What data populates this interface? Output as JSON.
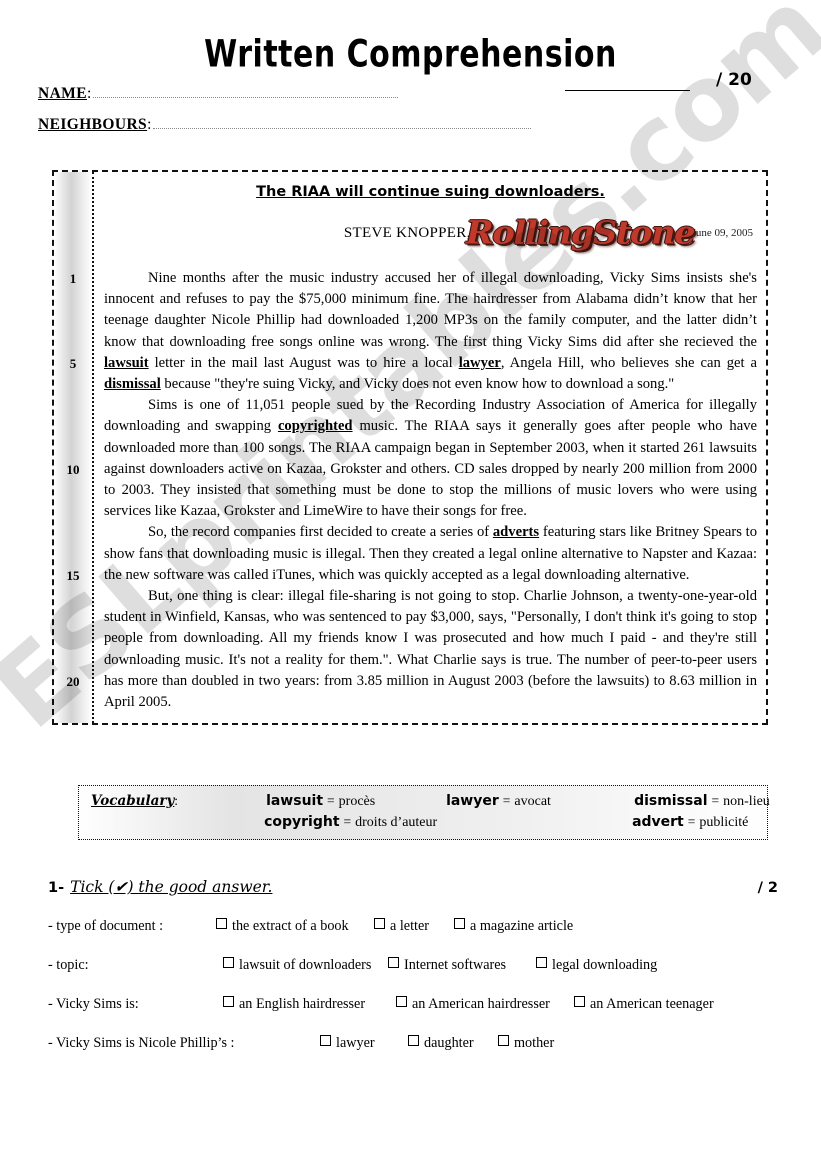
{
  "header": {
    "title": "Written Comprehension",
    "score_total": "/ 20",
    "name_label": "NAME",
    "neighbours_label": "NEIGHBOURS",
    "colon": ":"
  },
  "article": {
    "headline": "The RIAA will continue suing downloaders.",
    "author": "STEVE KNOPPER,",
    "magazine_logo": "RollingStone",
    "date": "June 09, 2005",
    "line_numbers": [
      "1",
      "5",
      "10",
      "15",
      "20"
    ],
    "paragraphs": [
      "Nine months after the music industry accused her of illegal downloading, Vicky Sims insists she's innocent and refuses to pay the $75,000 minimum fine. The hairdresser from Alabama didn’t know that her teenage daughter Nicole Phillip had downloaded 1,200 MP3s on the family computer, and the latter didn’t know that downloading free songs online was wrong. The first thing Vicky Sims did after she recieved the |lawsuit| letter in the mail last August was to hire a local |lawyer|, Angela Hill, who believes she can get a |dismissal| because \"they're suing Vicky, and Vicky does not even know how to download a song.\"",
      "Sims is one of 11,051 people sued by the Recording Industry Association of America for illegally downloading and swapping |copyrighted| music. The RIAA says it generally goes after people who have downloaded more than 100 songs. The RIAA campaign began in September 2003, when it started 261 lawsuits against downloaders active on Kazaa, Grokster and others. CD sales dropped by nearly 200 million from 2000 to 2003. They insisted that something must be done to stop the millions of music lovers who were using services like Kazaa, Grokster and LimeWire to have their songs for free.",
      "So, the record companies first decided to create a series of |adverts| featuring stars like Britney Spears to show fans that downloading music is illegal. Then they created a legal online alternative to Napster and Kazaa: the new software was called iTunes, which was quickly accepted as a legal downloading alternative.",
      "But, one thing is clear: illegal file-sharing is not going to stop.  Charlie Johnson, a twenty-one-year-old student in Winfield, Kansas, who was sentenced to pay $3,000, says, \"Personally, I don't think it's going to stop people from downloading. All my friends know I was prosecuted and how much I paid - and they're still downloading music. It's not a reality for them.\". What Charlie says is true. The number of peer-to-peer users has more than doubled in two years: from 3.85 million in August 2003 (before the lawsuits) to 8.63 million in April 2005."
    ]
  },
  "vocabulary": {
    "label": "Vocabulary",
    "colon": ":",
    "rows": [
      [
        {
          "en": "lawsuit",
          "eq": "=",
          "fr": "procès"
        },
        {
          "en": "lawyer",
          "eq": "=",
          "fr": "avocat"
        },
        {
          "en": "dismissal",
          "eq": "=",
          "fr": "non-lieu"
        }
      ],
      [
        {
          "en": "copyright",
          "eq": "=",
          "fr": "droits d’auteur"
        },
        {
          "en": "",
          "eq": "",
          "fr": ""
        },
        {
          "en": "advert",
          "eq": "=",
          "fr": "publicité"
        }
      ]
    ]
  },
  "exercise1": {
    "number": "1-",
    "instruction": "Tick (✔) the good answer.",
    "points": "/ 2",
    "questions": [
      {
        "label": "- type of document :",
        "options": [
          "the extract of a book",
          "a letter",
          "a magazine article"
        ]
      },
      {
        "label": "- topic:",
        "options": [
          "lawsuit of downloaders",
          "Internet softwares",
          "legal downloading"
        ]
      },
      {
        "label": "- Vicky Sims is:",
        "options": [
          "an English hairdresser",
          "an American hairdresser",
          "an American teenager"
        ]
      },
      {
        "label": "- Vicky Sims is Nicole Phillip’s :",
        "options": [
          "lawyer",
          "daughter",
          "mother"
        ]
      }
    ]
  },
  "watermark": {
    "text": "ESLprintables.com"
  }
}
